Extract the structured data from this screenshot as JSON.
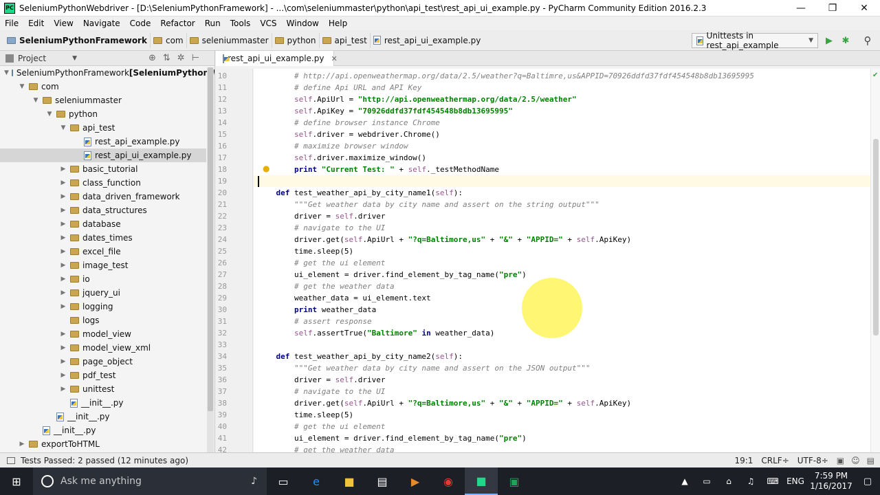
{
  "window": {
    "app_icon_text": "PC",
    "title": "SeleniumPythonWebdriver - [D:\\SeleniumPythonFramework] - ...\\com\\seleniummaster\\python\\api_test\\rest_api_ui_example.py - PyCharm Community Edition 2016.2.3",
    "minimize": "—",
    "maximize": "❐",
    "close": "✕"
  },
  "menu": [
    "File",
    "Edit",
    "View",
    "Navigate",
    "Code",
    "Refactor",
    "Run",
    "Tools",
    "VCS",
    "Window",
    "Help"
  ],
  "breadcrumbs": [
    "SeleniumPythonFramework",
    "com",
    "seleniummaster",
    "python",
    "api_test",
    "rest_api_ui_example.py"
  ],
  "run_config": {
    "label": "Unittests in rest_api_example",
    "run_icon": "▶",
    "debug_icon": "✱",
    "search_icon": "⚲"
  },
  "project_panel": {
    "title": "Project",
    "icons": [
      "⊕",
      "⇅",
      "✲",
      "⊢"
    ],
    "tree": [
      {
        "label": "SeleniumPythonFramework",
        "suffix": "[SeleniumPythonWebd",
        "level": 0,
        "toggle": "▼",
        "kind": "folder-blue"
      },
      {
        "label": "com",
        "level": 1,
        "toggle": "▼",
        "kind": "folder"
      },
      {
        "label": "seleniummaster",
        "level": 2,
        "toggle": "▼",
        "kind": "folder"
      },
      {
        "label": "python",
        "level": 3,
        "toggle": "▼",
        "kind": "folder"
      },
      {
        "label": "api_test",
        "level": 4,
        "toggle": "▼",
        "kind": "folder"
      },
      {
        "label": "rest_api_example.py",
        "level": 5,
        "toggle": "",
        "kind": "py"
      },
      {
        "label": "rest_api_ui_example.py",
        "level": 5,
        "toggle": "",
        "kind": "py",
        "selected": true
      },
      {
        "label": "basic_tutorial",
        "level": 4,
        "toggle": "▶",
        "kind": "folder"
      },
      {
        "label": "class_function",
        "level": 4,
        "toggle": "▶",
        "kind": "folder"
      },
      {
        "label": "data_driven_framework",
        "level": 4,
        "toggle": "▶",
        "kind": "folder"
      },
      {
        "label": "data_structures",
        "level": 4,
        "toggle": "▶",
        "kind": "folder"
      },
      {
        "label": "database",
        "level": 4,
        "toggle": "▶",
        "kind": "folder"
      },
      {
        "label": "dates_times",
        "level": 4,
        "toggle": "▶",
        "kind": "folder"
      },
      {
        "label": "excel_file",
        "level": 4,
        "toggle": "▶",
        "kind": "folder"
      },
      {
        "label": "image_test",
        "level": 4,
        "toggle": "▶",
        "kind": "folder"
      },
      {
        "label": "io",
        "level": 4,
        "toggle": "▶",
        "kind": "folder"
      },
      {
        "label": "jquery_ui",
        "level": 4,
        "toggle": "▶",
        "kind": "folder"
      },
      {
        "label": "logging",
        "level": 4,
        "toggle": "▶",
        "kind": "folder"
      },
      {
        "label": "logs",
        "level": 4,
        "toggle": "",
        "kind": "folder"
      },
      {
        "label": "model_view",
        "level": 4,
        "toggle": "▶",
        "kind": "folder"
      },
      {
        "label": "model_view_xml",
        "level": 4,
        "toggle": "▶",
        "kind": "folder"
      },
      {
        "label": "page_object",
        "level": 4,
        "toggle": "▶",
        "kind": "folder"
      },
      {
        "label": "pdf_test",
        "level": 4,
        "toggle": "▶",
        "kind": "folder"
      },
      {
        "label": "unittest",
        "level": 4,
        "toggle": "▶",
        "kind": "folder"
      },
      {
        "label": "__init__.py",
        "level": 4,
        "toggle": "",
        "kind": "py"
      },
      {
        "label": "__init__.py",
        "level": 3,
        "toggle": "",
        "kind": "py"
      },
      {
        "label": "__init__.py",
        "level": 2,
        "toggle": "",
        "kind": "py"
      },
      {
        "label": "exportToHTML",
        "level": 1,
        "toggle": "▶",
        "kind": "folder"
      }
    ]
  },
  "editor": {
    "tab": {
      "label": "rest_api_ui_example.py",
      "close": "✕"
    },
    "current_line": 19,
    "lines": [
      {
        "n": 10,
        "t": [
          [
            "cm",
            "        # http://api.openweathermap.org/data/2.5/weather?q=Baltimre,us&APPID=70926ddfd37fdf454548b8db13695995"
          ]
        ]
      },
      {
        "n": 11,
        "t": [
          [
            "cm",
            "        # define Api URL and API Key"
          ]
        ]
      },
      {
        "n": 12,
        "t": [
          [
            "",
            "        "
          ],
          [
            "self",
            "self"
          ],
          [
            "",
            ".ApiUrl = "
          ],
          [
            "str",
            "\"http://api.openweathermap.org/data/2.5/weather\""
          ]
        ]
      },
      {
        "n": 13,
        "t": [
          [
            "",
            "        "
          ],
          [
            "self",
            "self"
          ],
          [
            "",
            ".ApiKey = "
          ],
          [
            "str",
            "\"70926ddfd37fdf454548b8db13695995\""
          ]
        ]
      },
      {
        "n": 14,
        "t": [
          [
            "cm",
            "        # define browser instance Chrome"
          ]
        ]
      },
      {
        "n": 15,
        "t": [
          [
            "",
            "        "
          ],
          [
            "self",
            "self"
          ],
          [
            "",
            ".driver = webdriver.Chrome()"
          ]
        ]
      },
      {
        "n": 16,
        "t": [
          [
            "cm",
            "        # maximize browser window"
          ]
        ]
      },
      {
        "n": 17,
        "t": [
          [
            "",
            "        "
          ],
          [
            "self",
            "self"
          ],
          [
            "",
            ".driver.maximize_window()"
          ]
        ]
      },
      {
        "n": 18,
        "t": [
          [
            "",
            "        "
          ],
          [
            "kw",
            "print"
          ],
          [
            "",
            " "
          ],
          [
            "str",
            "\"Current Test: \""
          ],
          [
            "",
            " + "
          ],
          [
            "self",
            "self"
          ],
          [
            "",
            "._testMethodName"
          ]
        ]
      },
      {
        "n": 19,
        "t": [
          [
            "",
            ""
          ]
        ]
      },
      {
        "n": 20,
        "t": [
          [
            "",
            "    "
          ],
          [
            "kw",
            "def"
          ],
          [
            "",
            " test_weather_api_by_city_name1("
          ],
          [
            "self",
            "self"
          ],
          [
            "",
            "):"
          ]
        ]
      },
      {
        "n": 21,
        "t": [
          [
            "cm",
            "        \"\"\"Get weather data by city name and assert on the string output\"\"\""
          ]
        ]
      },
      {
        "n": 22,
        "t": [
          [
            "",
            "        driver = "
          ],
          [
            "self",
            "self"
          ],
          [
            "",
            ".driver"
          ]
        ]
      },
      {
        "n": 23,
        "t": [
          [
            "cm",
            "        # navigate to the UI"
          ]
        ]
      },
      {
        "n": 24,
        "t": [
          [
            "",
            "        driver.get("
          ],
          [
            "self",
            "self"
          ],
          [
            "",
            ".ApiUrl + "
          ],
          [
            "str",
            "\"?q=Baltimore,us\""
          ],
          [
            "",
            " + "
          ],
          [
            "str",
            "\"&\""
          ],
          [
            "",
            " + "
          ],
          [
            "str",
            "\"APPID=\""
          ],
          [
            "",
            " + "
          ],
          [
            "self",
            "self"
          ],
          [
            "",
            ".ApiKey)"
          ]
        ]
      },
      {
        "n": 25,
        "t": [
          [
            "",
            "        time.sleep(5)"
          ]
        ]
      },
      {
        "n": 26,
        "t": [
          [
            "cm",
            "        # get the ui element"
          ]
        ]
      },
      {
        "n": 27,
        "t": [
          [
            "",
            "        ui_element = driver.find_element_by_tag_name("
          ],
          [
            "str",
            "\"pre\""
          ],
          [
            "",
            ")"
          ]
        ]
      },
      {
        "n": 28,
        "t": [
          [
            "cm",
            "        # get the weather data"
          ]
        ]
      },
      {
        "n": 29,
        "t": [
          [
            "",
            "        weather_data = ui_element.text"
          ]
        ]
      },
      {
        "n": 30,
        "t": [
          [
            "",
            "        "
          ],
          [
            "kw",
            "print"
          ],
          [
            "",
            " weather_data"
          ]
        ]
      },
      {
        "n": 31,
        "t": [
          [
            "cm",
            "        # assert response"
          ]
        ]
      },
      {
        "n": 32,
        "t": [
          [
            "",
            "        "
          ],
          [
            "self",
            "self"
          ],
          [
            "",
            ".assertTrue("
          ],
          [
            "str",
            "\"Baltimore\""
          ],
          [
            "",
            " "
          ],
          [
            "kw",
            "in"
          ],
          [
            "",
            " weather_data)"
          ]
        ]
      },
      {
        "n": 33,
        "t": [
          [
            "",
            ""
          ]
        ]
      },
      {
        "n": 34,
        "t": [
          [
            "",
            "    "
          ],
          [
            "kw",
            "def"
          ],
          [
            "",
            " test_weather_api_by_city_name2("
          ],
          [
            "self",
            "self"
          ],
          [
            "",
            "):"
          ]
        ]
      },
      {
        "n": 35,
        "t": [
          [
            "cm",
            "        \"\"\"Get weather data by city name and assert on the JSON output\"\"\""
          ]
        ]
      },
      {
        "n": 36,
        "t": [
          [
            "",
            "        driver = "
          ],
          [
            "self",
            "self"
          ],
          [
            "",
            ".driver"
          ]
        ]
      },
      {
        "n": 37,
        "t": [
          [
            "cm",
            "        # navigate to the UI"
          ]
        ]
      },
      {
        "n": 38,
        "t": [
          [
            "",
            "        driver.get("
          ],
          [
            "self",
            "self"
          ],
          [
            "",
            ".ApiUrl + "
          ],
          [
            "str",
            "\"?q=Baltimore,us\""
          ],
          [
            "",
            " + "
          ],
          [
            "str",
            "\"&\""
          ],
          [
            "",
            " + "
          ],
          [
            "str",
            "\"APPID=\""
          ],
          [
            "",
            " + "
          ],
          [
            "self",
            "self"
          ],
          [
            "",
            ".ApiKey)"
          ]
        ]
      },
      {
        "n": 39,
        "t": [
          [
            "",
            "        time.sleep(5)"
          ]
        ]
      },
      {
        "n": 40,
        "t": [
          [
            "cm",
            "        # get the ui element"
          ]
        ]
      },
      {
        "n": 41,
        "t": [
          [
            "",
            "        ui_element = driver.find_element_by_tag_name("
          ],
          [
            "str",
            "\"pre\""
          ],
          [
            "",
            ")"
          ]
        ]
      },
      {
        "n": 42,
        "t": [
          [
            "cm",
            "        # get the weather data"
          ]
        ]
      }
    ]
  },
  "status": {
    "message": "Tests Passed: 2 passed (12 minutes ago)",
    "position": "19:1",
    "line_sep": "CRLF÷",
    "encoding": "UTF-8÷"
  },
  "taskbar": {
    "search_placeholder": "Ask me anything",
    "time": "7:59 PM",
    "date": "1/16/2017",
    "lang": "ENG"
  },
  "colors": {
    "keyword": "#000080",
    "string": "#008000",
    "comment": "#808080",
    "self": "#94558d",
    "run_green": "#3ba243"
  }
}
